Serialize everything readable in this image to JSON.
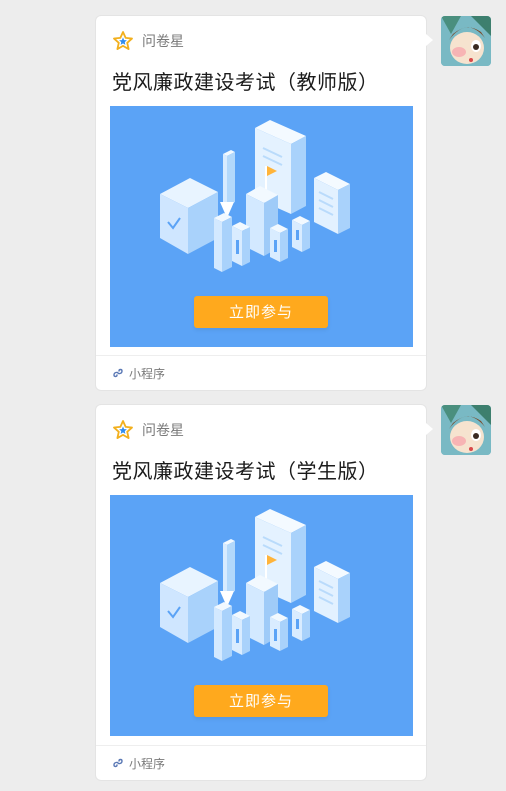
{
  "messages": [
    {
      "app_name": "问卷星",
      "title": "党风廉政建设考试（教师版）",
      "button_label": "立即参与",
      "footer_label": "小程序"
    },
    {
      "app_name": "问卷星",
      "title": "党风廉政建设考试（学生版）",
      "button_label": "立即参与",
      "footer_label": "小程序"
    }
  ],
  "colors": {
    "background": "#ededed",
    "cover": "#5ba3f6",
    "button": "#ffa91d",
    "star": "#f2b01e"
  },
  "icons": {
    "app": "star-icon",
    "footer": "mini-program-icon"
  }
}
